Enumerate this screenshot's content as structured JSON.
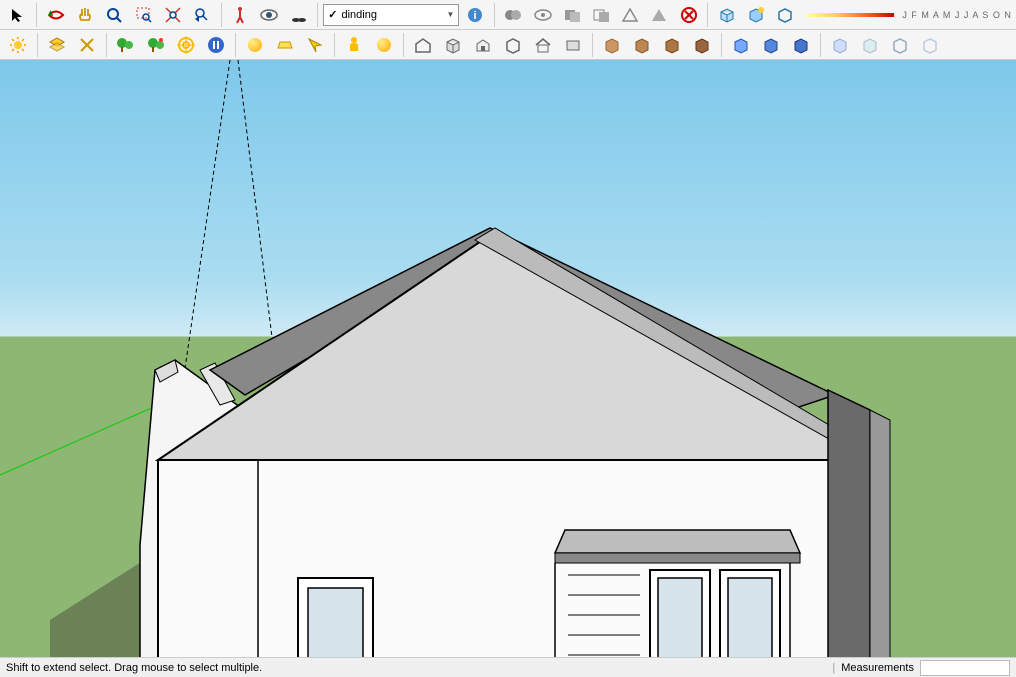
{
  "layer": {
    "check": "✓",
    "name": "dinding"
  },
  "months": "J F M A M J J A S O N",
  "status": {
    "hint": "Shift to extend select. Drag mouse to select multiple.",
    "measurements_label": "Measurements"
  },
  "toolbar1": {
    "sel": "Select",
    "kite": "Rotate",
    "hand": "Pan",
    "zoomin": "Zoom",
    "zoomwin": "Zoom Window",
    "zoomext": "Zoom Extents",
    "prev": "Previous",
    "walk": "Walk",
    "look": "Look Around",
    "feet": "Position Camera",
    "info": "Info",
    "solid1": "Solid Tool",
    "eye": "View",
    "solid2": "Solid",
    "extrude": "Extrude",
    "intersect": "Intersect",
    "trim": "Trim",
    "x": "Delete",
    "blue1": "Component",
    "blue2": "Paint",
    "blue3": "Style"
  },
  "toolbar2": {
    "sun": "Sun",
    "layers": "Layers",
    "xray": "X-Ray",
    "tree1": "Vegetation",
    "tree2": "Trees",
    "target": "Target",
    "pause": "Pause",
    "sphere": "Sphere",
    "plane": "Plane",
    "arrow": "Arrow",
    "person": "Person",
    "orange": "Orange",
    "house1": "House",
    "box1": "Box",
    "house2": "House Small",
    "box2": "Box Open",
    "house3": "House Roof",
    "box3": "Box Flat",
    "brown1": "Material 1",
    "brown2": "Material 2",
    "brown3": "Material 3",
    "brown4": "Material 4",
    "blue1": "Blue 1",
    "blue2": "Blue 2",
    "blue3": "Blue 3",
    "lt1": "Light 1",
    "lt2": "Light 2",
    "lt3": "Light 3",
    "lt4": "Light 4"
  }
}
